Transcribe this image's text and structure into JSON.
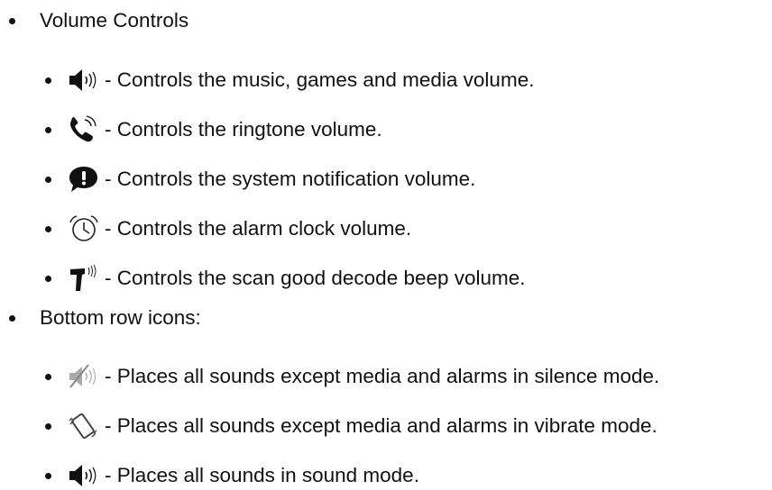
{
  "volume_section": {
    "heading": "Volume Controls",
    "items": [
      {
        "icon": "speaker-volume-icon",
        "text": "- Controls the music, games and media volume."
      },
      {
        "icon": "phone-ringtone-icon",
        "text": "- Controls the ringtone volume."
      },
      {
        "icon": "notification-bubble-icon",
        "text": "- Controls the system notification volume."
      },
      {
        "icon": "alarm-clock-icon",
        "text": "- Controls the alarm clock volume."
      },
      {
        "icon": "scanner-beep-icon",
        "text": "- Controls the scan good decode beep volume."
      }
    ]
  },
  "bottom_section": {
    "heading": "Bottom row icons:",
    "items": [
      {
        "icon": "speaker-muted-icon",
        "text": "- Places all sounds except media and alarms in silence mode."
      },
      {
        "icon": "vibrate-phone-icon",
        "text": "- Places all sounds except media and alarms in vibrate mode."
      },
      {
        "icon": "speaker-sound-icon",
        "text": "- Places all sounds in sound mode."
      }
    ]
  }
}
